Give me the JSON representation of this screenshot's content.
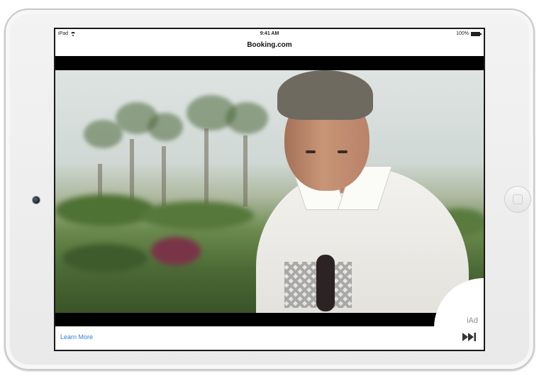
{
  "status_bar": {
    "device": "iPad",
    "time": "9:41 AM",
    "battery": "100%",
    "icons": [
      "wifi-icon",
      "battery-icon"
    ]
  },
  "header": {
    "title": "Booking.com"
  },
  "ad": {
    "badge": "iAd",
    "learn_more_label": "Learn More",
    "skip_icon": "fast-forward-icon"
  },
  "colors": {
    "link": "#2f7fd1",
    "letterbox": "#000000"
  }
}
